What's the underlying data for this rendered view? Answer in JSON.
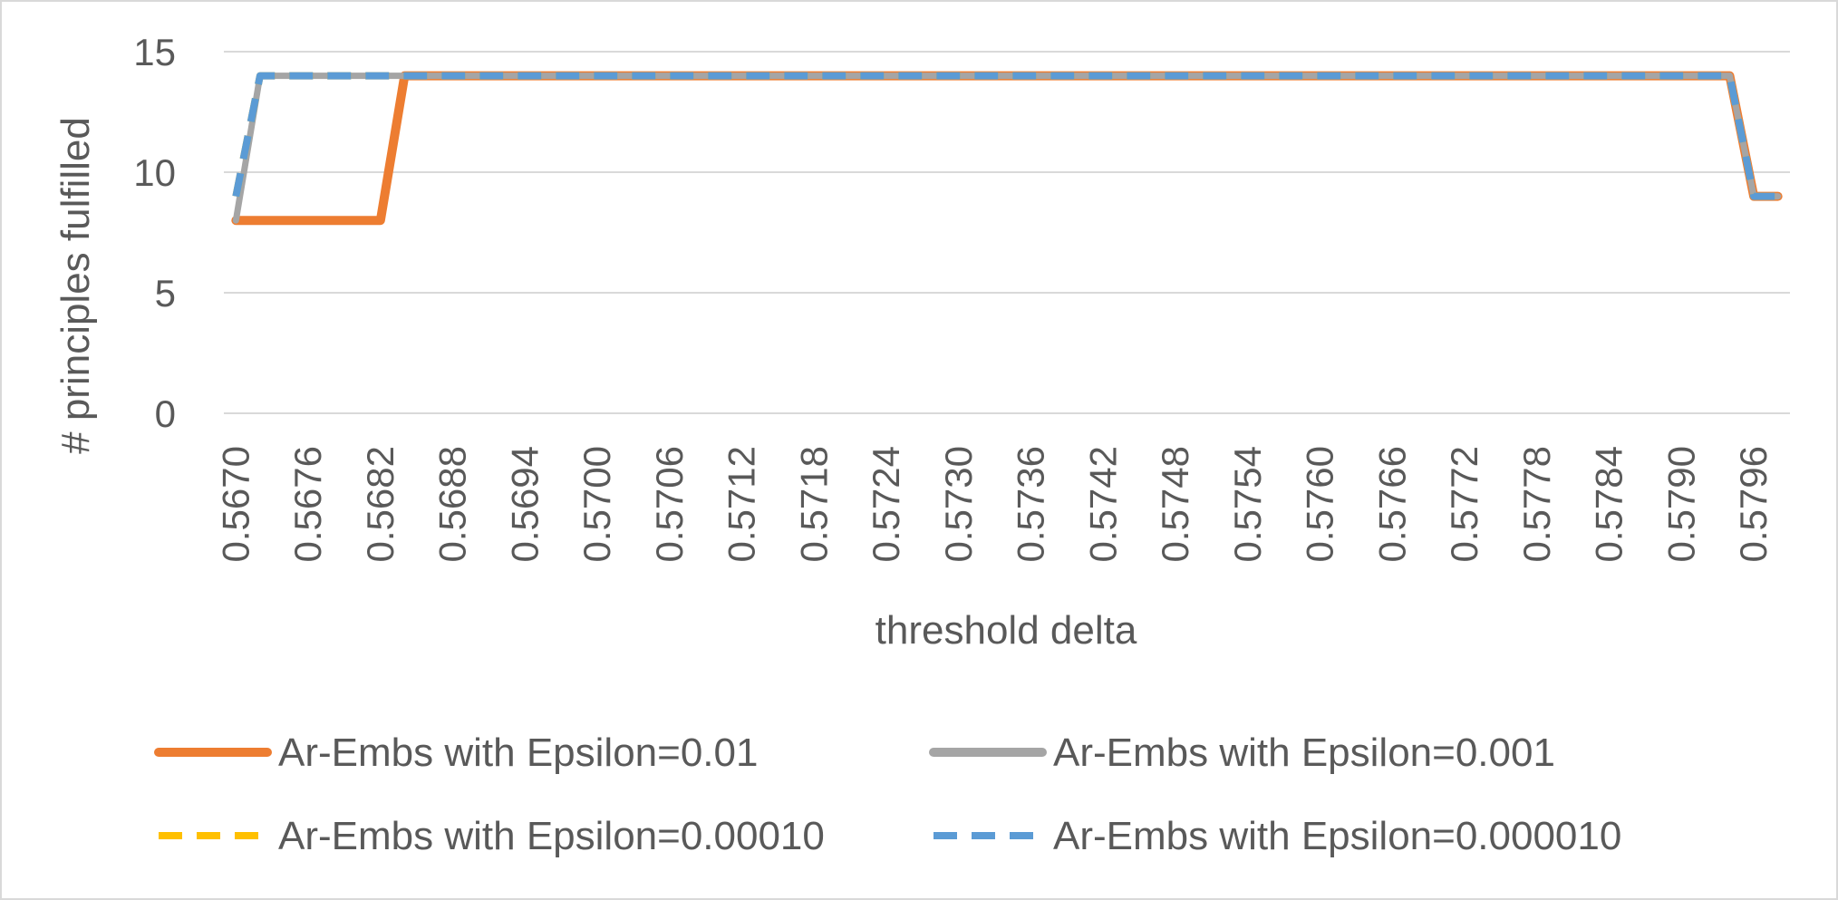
{
  "chart_data": {
    "type": "line",
    "xlabel": "threshold delta",
    "ylabel": "# principles fulfilled",
    "ylim": [
      0,
      15
    ],
    "yticks": [
      "0",
      "5",
      "10",
      "15"
    ],
    "grid": true,
    "legend_position": "bottom",
    "categories": [
      "0.5670",
      "0.5672",
      "0.5674",
      "0.5676",
      "0.5678",
      "0.5680",
      "0.5682",
      "0.5684",
      "0.5686",
      "0.5688",
      "0.5690",
      "0.5692",
      "0.5694",
      "0.5696",
      "0.5698",
      "0.5700",
      "0.5702",
      "0.5704",
      "0.5706",
      "0.5708",
      "0.5710",
      "0.5712",
      "0.5714",
      "0.5716",
      "0.5718",
      "0.5720",
      "0.5722",
      "0.5724",
      "0.5726",
      "0.5728",
      "0.5730",
      "0.5732",
      "0.5734",
      "0.5736",
      "0.5738",
      "0.5740",
      "0.5742",
      "0.5744",
      "0.5746",
      "0.5748",
      "0.5750",
      "0.5752",
      "0.5754",
      "0.5756",
      "0.5758",
      "0.5760",
      "0.5762",
      "0.5764",
      "0.5766",
      "0.5768",
      "0.5770",
      "0.5772",
      "0.5774",
      "0.5776",
      "0.5778",
      "0.5780",
      "0.5782",
      "0.5784",
      "0.5786",
      "0.5788",
      "0.5790",
      "0.5792",
      "0.5794",
      "0.5796",
      "0.5798"
    ],
    "tick_labels": [
      "0.5670",
      "0.5676",
      "0.5682",
      "0.5688",
      "0.5694",
      "0.5700",
      "0.5706",
      "0.5712",
      "0.5718",
      "0.5724",
      "0.5730",
      "0.5736",
      "0.5742",
      "0.5748",
      "0.5754",
      "0.5760",
      "0.5766",
      "0.5772",
      "0.5778",
      "0.5784",
      "0.5790",
      "0.5796"
    ],
    "series": [
      {
        "name": "Ar-Embs with Epsilon=0.01",
        "color": "#ED7D31",
        "style": "solid",
        "values": [
          8,
          8,
          8,
          8,
          8,
          8,
          8,
          14,
          14,
          14,
          14,
          14,
          14,
          14,
          14,
          14,
          14,
          14,
          14,
          14,
          14,
          14,
          14,
          14,
          14,
          14,
          14,
          14,
          14,
          14,
          14,
          14,
          14,
          14,
          14,
          14,
          14,
          14,
          14,
          14,
          14,
          14,
          14,
          14,
          14,
          14,
          14,
          14,
          14,
          14,
          14,
          14,
          14,
          14,
          14,
          14,
          14,
          14,
          14,
          14,
          14,
          14,
          14,
          9,
          9
        ]
      },
      {
        "name": "Ar-Embs with Epsilon=0.001",
        "color": "#A5A5A5",
        "style": "solid",
        "values": [
          8,
          14,
          14,
          14,
          14,
          14,
          14,
          14,
          14,
          14,
          14,
          14,
          14,
          14,
          14,
          14,
          14,
          14,
          14,
          14,
          14,
          14,
          14,
          14,
          14,
          14,
          14,
          14,
          14,
          14,
          14,
          14,
          14,
          14,
          14,
          14,
          14,
          14,
          14,
          14,
          14,
          14,
          14,
          14,
          14,
          14,
          14,
          14,
          14,
          14,
          14,
          14,
          14,
          14,
          14,
          14,
          14,
          14,
          14,
          14,
          14,
          14,
          14,
          9,
          9
        ]
      },
      {
        "name": "Ar-Embs with Epsilon=0.00010",
        "color": "#FFC000",
        "style": "dashed",
        "values": [
          9,
          14,
          14,
          14,
          14,
          14,
          14,
          14,
          14,
          14,
          14,
          14,
          14,
          14,
          14,
          14,
          14,
          14,
          14,
          14,
          14,
          14,
          14,
          14,
          14,
          14,
          14,
          14,
          14,
          14,
          14,
          14,
          14,
          14,
          14,
          14,
          14,
          14,
          14,
          14,
          14,
          14,
          14,
          14,
          14,
          14,
          14,
          14,
          14,
          14,
          14,
          14,
          14,
          14,
          14,
          14,
          14,
          14,
          14,
          14,
          14,
          14,
          14,
          9,
          9
        ]
      },
      {
        "name": "Ar-Embs with Epsilon=0.000010",
        "color": "#5B9BD5",
        "style": "dashed",
        "values": [
          9,
          14,
          14,
          14,
          14,
          14,
          14,
          14,
          14,
          14,
          14,
          14,
          14,
          14,
          14,
          14,
          14,
          14,
          14,
          14,
          14,
          14,
          14,
          14,
          14,
          14,
          14,
          14,
          14,
          14,
          14,
          14,
          14,
          14,
          14,
          14,
          14,
          14,
          14,
          14,
          14,
          14,
          14,
          14,
          14,
          14,
          14,
          14,
          14,
          14,
          14,
          14,
          14,
          14,
          14,
          14,
          14,
          14,
          14,
          14,
          14,
          14,
          14,
          9,
          9
        ]
      }
    ]
  }
}
